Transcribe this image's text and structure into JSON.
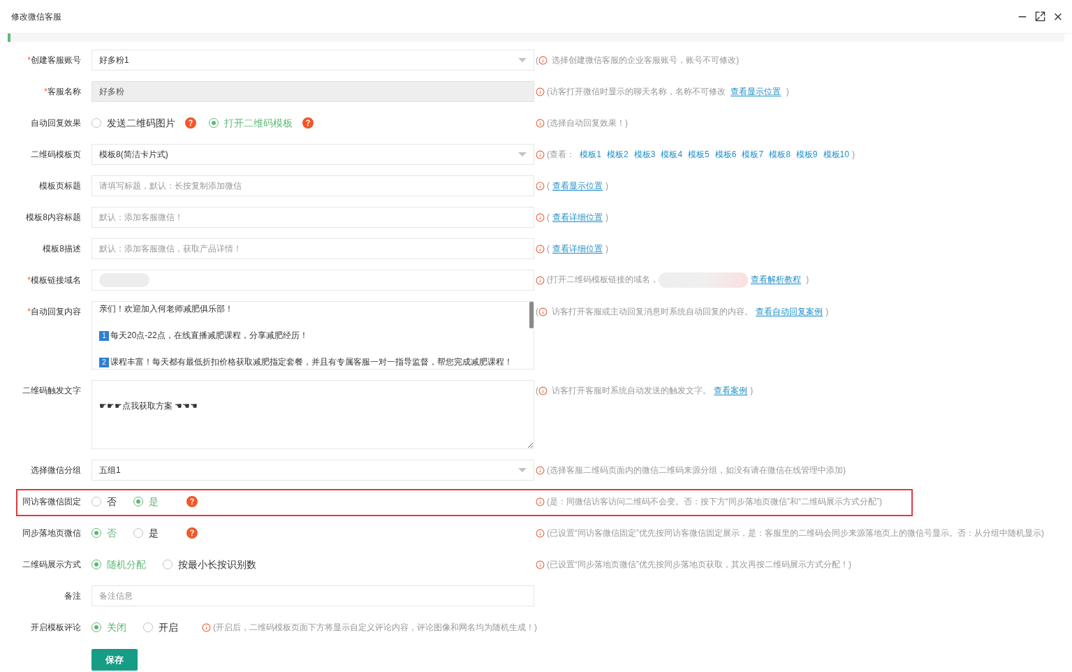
{
  "window": {
    "title": "修改微信客服"
  },
  "form": {
    "fields": [
      {
        "kind": "select",
        "required_mark": "*",
        "label": "创建客服账号",
        "value": "好多粉1",
        "hint": {
          "lead": "(",
          "parts": [
            {
              "kind": "text",
              "text": " 选择创建微信客服的企业客服账号，账号不可修改)"
            }
          ]
        }
      },
      {
        "kind": "input",
        "required_mark": "*",
        "label": "客服名称",
        "value": "好多粉",
        "disabled": true,
        "hint": {
          "parts": [
            {
              "kind": "text",
              "text": "(访客打开微信时显示的聊天名称，名称不可修改 "
            },
            {
              "kind": "link",
              "text": "查看显示位置",
              "underlined": true
            },
            {
              "kind": "text",
              "text": " )"
            }
          ]
        }
      },
      {
        "kind": "radio",
        "label": "自动回复效果",
        "options": [
          {
            "label": "发送二维码图片",
            "selected": false,
            "help": true
          },
          {
            "label": "打开二维码模板",
            "selected": true,
            "help": true
          }
        ],
        "hint": {
          "parts": [
            {
              "kind": "text",
              "text": "(选择自动回复效果！)"
            }
          ]
        }
      },
      {
        "kind": "select",
        "label": "二维码模板页",
        "value": "模板8(简洁卡片式)",
        "hint": {
          "parts": [
            {
              "kind": "text",
              "text": "(查看： "
            },
            {
              "kind": "link",
              "text": "模板1",
              "underlined": false
            },
            {
              "kind": "link",
              "text": "模板2",
              "underlined": false
            },
            {
              "kind": "link",
              "text": "模板3",
              "underlined": false
            },
            {
              "kind": "link",
              "text": "模板4",
              "underlined": false
            },
            {
              "kind": "link",
              "text": "模板5",
              "underlined": false
            },
            {
              "kind": "link",
              "text": "模板6",
              "underlined": false
            },
            {
              "kind": "link",
              "text": "模板7",
              "underlined": false
            },
            {
              "kind": "link",
              "text": "模板8",
              "underlined": false
            },
            {
              "kind": "link",
              "text": "模板9",
              "underlined": false
            },
            {
              "kind": "link",
              "text": "模板10",
              "underlined": false
            },
            {
              "kind": "text",
              "text": ")"
            }
          ]
        }
      },
      {
        "kind": "input",
        "label": "模板页标题",
        "placeholder": "请填写标题，默认：长按复制添加微信",
        "hint": {
          "parts": [
            {
              "kind": "text",
              "text": "("
            },
            {
              "kind": "link",
              "text": "查看显示位置",
              "underlined": true
            },
            {
              "kind": "text",
              "text": ")"
            }
          ]
        }
      },
      {
        "kind": "input",
        "label": "模板8内容标题",
        "placeholder": "默认：添加客服微信！",
        "hint": {
          "parts": [
            {
              "kind": "text",
              "text": "("
            },
            {
              "kind": "link",
              "text": "查看详细位置",
              "underlined": true
            },
            {
              "kind": "text",
              "text": ")"
            }
          ]
        }
      },
      {
        "kind": "input",
        "label": "模板8描述",
        "placeholder": "默认：添加客服微信，获取产品详情！",
        "hint": {
          "parts": [
            {
              "kind": "text",
              "text": "("
            },
            {
              "kind": "link",
              "text": "查看详细位置",
              "underlined": true
            },
            {
              "kind": "text",
              "text": ")"
            }
          ]
        }
      },
      {
        "kind": "input",
        "required_mark": "*",
        "label": "模板链接域名",
        "redacted": true,
        "hint": {
          "parts": [
            {
              "kind": "text",
              "text": "(打开二维码模板链接的域名，"
            },
            {
              "kind": "redacted"
            },
            {
              "kind": "link",
              "text": "查看解析教程",
              "underlined": true
            },
            {
              "kind": "text",
              "text": " )"
            }
          ]
        }
      },
      {
        "kind": "rich_textarea",
        "required_mark": "*",
        "label": "自动回复内容",
        "paragraphs": [
          {
            "text": "亲们！欢迎加入何老师减肥俱乐部！"
          },
          {
            "badge": "1",
            "text": "每天20点-22点，在线直播减肥课程，分享减肥经历！"
          },
          {
            "badge": "2",
            "text": "课程丰富！每天都有最低折扣价格获取减肥指定套餐，并且有专属客服一对一指导监督，帮您完成减肥课程！"
          }
        ],
        "hint": {
          "lead": "(",
          "parts": [
            {
              "kind": "text",
              "text": " 访客打开客服或主动回复消息时系统自动回复的内容。"
            },
            {
              "kind": "link",
              "text": "查看自动回复案例",
              "underlined": true
            },
            {
              "kind": "text",
              "text": ")"
            }
          ]
        }
      },
      {
        "kind": "textarea",
        "label": "二维码触发文字",
        "value": "☛☛☛点我获取方案 ☚☚☚",
        "hint": {
          "lead": "(",
          "parts": [
            {
              "kind": "text",
              "text": " 访客打开客服时系统自动发送的触发文字。"
            },
            {
              "kind": "link",
              "text": "查看案例",
              "underlined": true
            },
            {
              "kind": "text",
              "text": ")"
            }
          ]
        }
      },
      {
        "kind": "select",
        "label": "选择微信分组",
        "value": "五组1",
        "hint": {
          "parts": [
            {
              "kind": "text",
              "text": "(选择客服二维码页面内的微信二维码来源分组，如没有请在微信在线管理中添加)"
            }
          ]
        }
      },
      {
        "kind": "radio",
        "label": "同访客微信固定",
        "highlighted": true,
        "help": true,
        "options": [
          {
            "label": "否",
            "selected": false
          },
          {
            "label": "是",
            "selected": true
          }
        ],
        "hint": {
          "parts": [
            {
              "kind": "text",
              "text": "(是：同微信访客访问二维码不会变。否：按下方“同步落地页微信”和“二维码展示方式分配”)"
            }
          ]
        }
      },
      {
        "kind": "radio",
        "label": "同步落地页微信",
        "help": true,
        "options": [
          {
            "label": "否",
            "selected": true
          },
          {
            "label": "是",
            "selected": false
          }
        ],
        "hint": {
          "parts": [
            {
              "kind": "text",
              "text": "(已设置“同访客微信固定”优先按同访客微信固定展示，是：客服里的二维码会同步来源落地页上的微信号显示。否：从分组中随机显示)"
            }
          ]
        }
      },
      {
        "kind": "radio",
        "label": "二维码展示方式",
        "options": [
          {
            "label": "随机分配",
            "selected": true
          },
          {
            "label": "按最小长按识别数",
            "selected": false
          }
        ],
        "hint": {
          "parts": [
            {
              "kind": "text",
              "text": "(已设置“同步落地页微信”优先按同步落地页获取，其次再按二维码展示方式分配！)"
            }
          ]
        }
      },
      {
        "kind": "input",
        "label": "备注",
        "placeholder": "备注信息"
      },
      {
        "kind": "radio",
        "label": "开启模板评论",
        "hint_inline": true,
        "options": [
          {
            "label": "关闭",
            "selected": true
          },
          {
            "label": "开启",
            "selected": false
          }
        ],
        "hint": {
          "parts": [
            {
              "kind": "text",
              "text": "(开启后，二维码模板页面下方将显示自定义评论内容，评论图像和网名均为随机生成！)"
            }
          ]
        }
      }
    ]
  },
  "save_button": {
    "label": "保存"
  }
}
